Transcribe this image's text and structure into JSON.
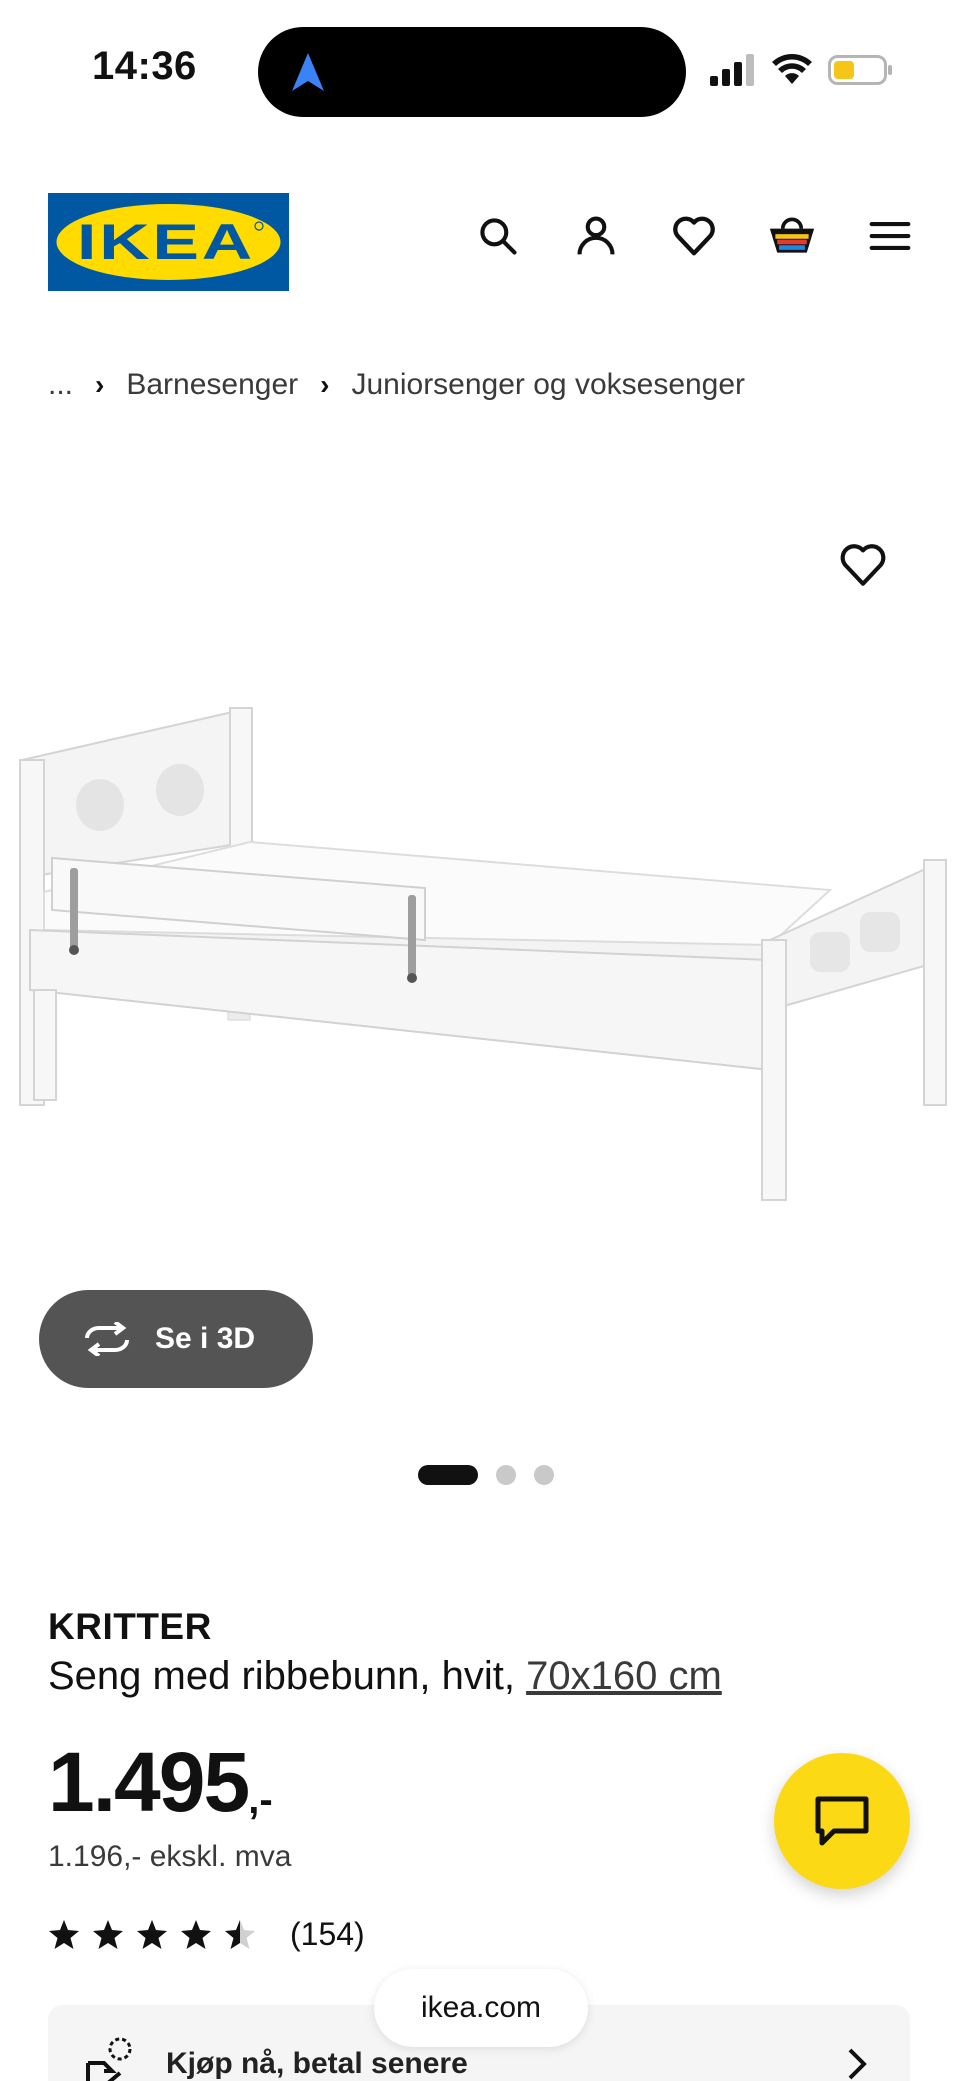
{
  "status_bar": {
    "time": "14:36",
    "icons": [
      "location-arrow-icon",
      "cellular-signal-icon",
      "wifi-icon",
      "battery-icon"
    ]
  },
  "header": {
    "logo_text": "IKEA",
    "icons": [
      "search-icon",
      "account-icon",
      "favorites-icon",
      "cart-icon",
      "menu-icon"
    ]
  },
  "breadcrumb": {
    "ellipsis": "...",
    "items": [
      "Barnesenger",
      "Juniorsenger og voksesenger"
    ]
  },
  "gallery": {
    "view_3d_label": "Se i 3D",
    "page_count": 3,
    "active_page": 1
  },
  "product": {
    "name": "KRITTER",
    "description": "Seng med ribbebunn, hvit, ",
    "size": "70x160 cm",
    "price": "1.495",
    "price_suffix": ",-",
    "price_ex_vat": "1.196,- ekskl. mva",
    "rating": 4.5,
    "rating_max": 5,
    "review_count": "(154)"
  },
  "buy_now": {
    "label": "Kjøp nå, betal senere"
  },
  "browser": {
    "url": "ikea.com"
  },
  "colors": {
    "ikea_blue": "#0058A3",
    "ikea_yellow": "#FFDB00",
    "chat_yellow": "#FBD914",
    "button_gray": "#545454"
  }
}
